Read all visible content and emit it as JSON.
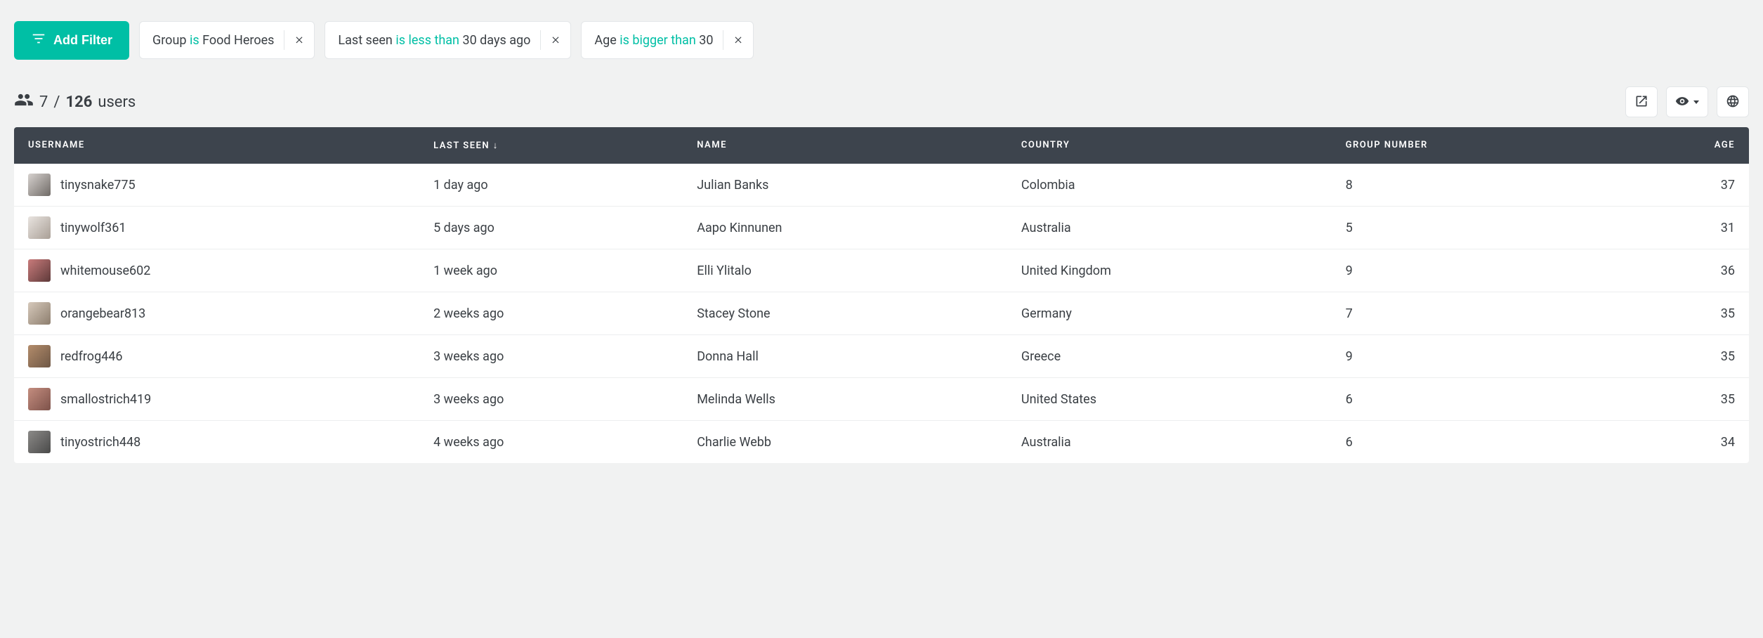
{
  "filters": {
    "add_label": "Add Filter",
    "chips": [
      {
        "field": "Group",
        "op": "is",
        "value": "Food Heroes"
      },
      {
        "field": "Last seen",
        "op": "is less than",
        "value": "30 days ago"
      },
      {
        "field": "Age",
        "op": "is bigger than",
        "value": "30"
      }
    ]
  },
  "summary": {
    "filtered": "7",
    "sep": "/",
    "total": "126",
    "word": "users"
  },
  "columns": {
    "username": "Username",
    "last_seen": "Last seen ↓",
    "name": "Name",
    "country": "Country",
    "group_number": "Group Number",
    "age": "Age"
  },
  "rows": [
    {
      "username": "tinysnake775",
      "last_seen": "1 day ago",
      "name": "Julian Banks",
      "country": "Colombia",
      "group_number": "8",
      "age": "37"
    },
    {
      "username": "tinywolf361",
      "last_seen": "5 days ago",
      "name": "Aapo Kinnunen",
      "country": "Australia",
      "group_number": "5",
      "age": "31"
    },
    {
      "username": "whitemouse602",
      "last_seen": "1 week ago",
      "name": "Elli Ylitalo",
      "country": "United Kingdom",
      "group_number": "9",
      "age": "36"
    },
    {
      "username": "orangebear813",
      "last_seen": "2 weeks ago",
      "name": "Stacey Stone",
      "country": "Germany",
      "group_number": "7",
      "age": "35"
    },
    {
      "username": "redfrog446",
      "last_seen": "3 weeks ago",
      "name": "Donna Hall",
      "country": "Greece",
      "group_number": "9",
      "age": "35"
    },
    {
      "username": "smallostrich419",
      "last_seen": "3 weeks ago",
      "name": "Melinda Wells",
      "country": "United States",
      "group_number": "6",
      "age": "35"
    },
    {
      "username": "tinyostrich448",
      "last_seen": "4 weeks ago",
      "name": "Charlie Webb",
      "country": "Australia",
      "group_number": "6",
      "age": "34"
    }
  ]
}
